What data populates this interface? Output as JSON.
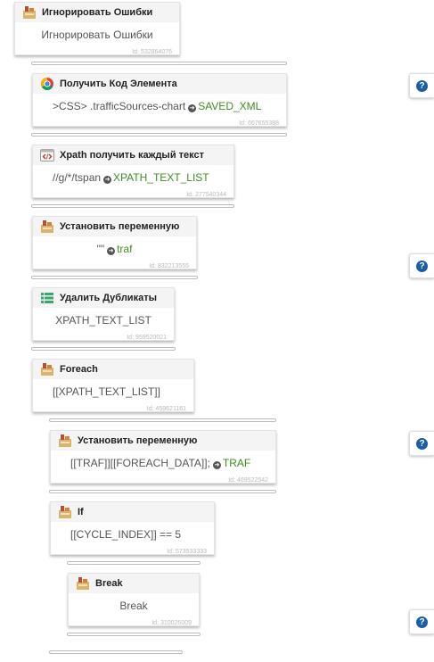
{
  "blocks": [
    {
      "title": "Игнорировать Ошибки",
      "icon": "zenno-block-icon",
      "body": "Игнорировать Ошибки",
      "id_label": "Id: 532864076"
    },
    {
      "title": "Получить Код Элемента",
      "icon": "chrome-icon",
      "body": ">CSS> .trafficSources-chart",
      "target": "SAVED_XML",
      "id_label": "Id: 667655388"
    },
    {
      "title": "Xpath получить каждый текст",
      "icon": "code-tag-icon",
      "body": "//g/*/tspan",
      "target": "XPATH_TEXT_LIST",
      "id_label": "Id: 277540344"
    },
    {
      "title": "Установить переменную",
      "icon": "zenno-block-icon",
      "body": "\"\"",
      "target": "traf",
      "id_label": "Id: 832213555"
    },
    {
      "title": "Удалить Дубликаты",
      "icon": "list-icon",
      "body": "XPATH_TEXT_LIST",
      "id_label": "Id: 959520021"
    },
    {
      "title": "Foreach",
      "icon": "zenno-block-icon",
      "body": "[[XPATH_TEXT_LIST]]",
      "id_label": "Id: 459621161"
    },
    {
      "title": "Установить переменную",
      "icon": "zenno-block-icon",
      "body": "[[TRAF]][[FOREACH_DATA]];",
      "target": "TRAF",
      "id_label": "Id: 469522542"
    },
    {
      "title": "If",
      "icon": "zenno-block-icon",
      "body": "[[CYCLE_INDEX]] == 5",
      "id_label": "Id: 573533333"
    },
    {
      "title": "Break",
      "icon": "zenno-block-icon",
      "body": "Break",
      "id_label": "Id: 310026009"
    }
  ],
  "help": {
    "label": "?"
  },
  "colors": {
    "variable": "#3e8e1f",
    "help": "#1a5ea8"
  }
}
